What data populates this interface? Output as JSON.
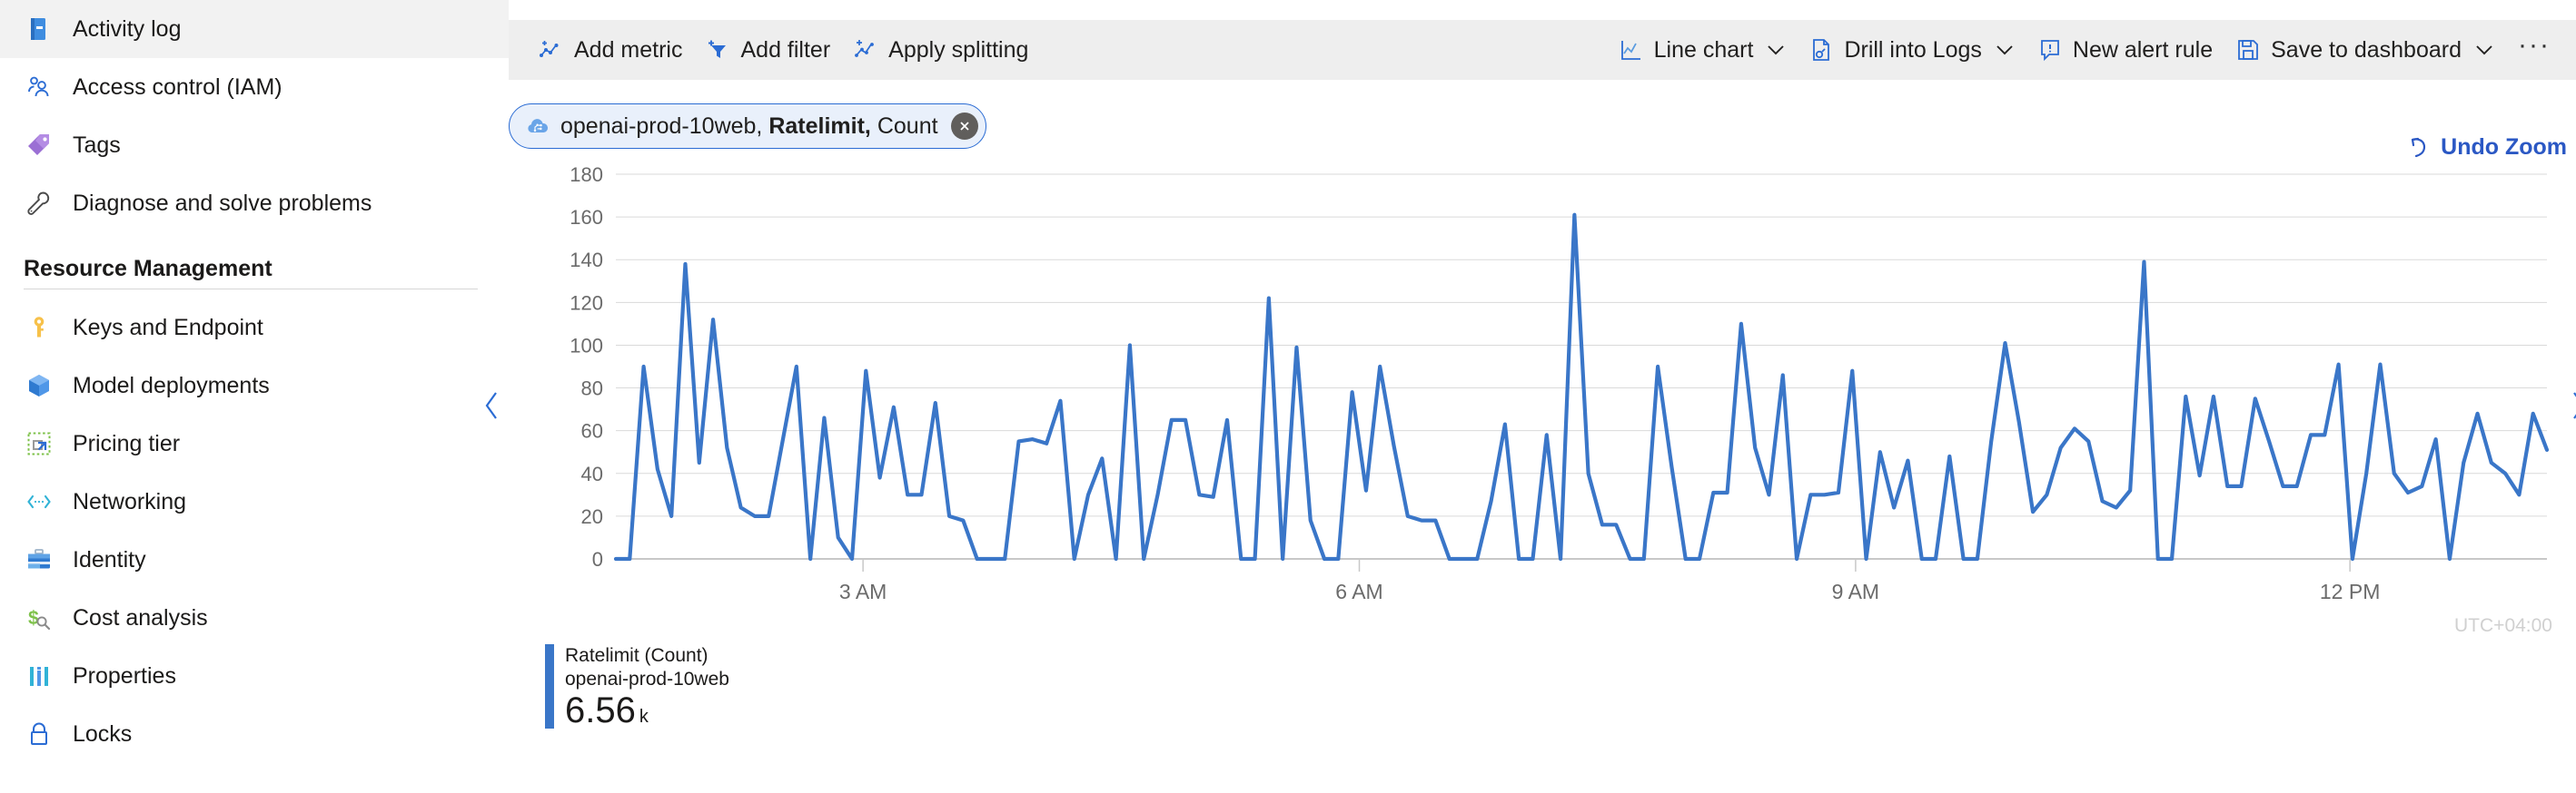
{
  "sidebar": {
    "items": [
      {
        "label": "Activity log",
        "icon": "activity-log-icon"
      },
      {
        "label": "Access control (IAM)",
        "icon": "access-control-icon"
      },
      {
        "label": "Tags",
        "icon": "tag-icon"
      },
      {
        "label": "Diagnose and solve problems",
        "icon": "wrench-icon"
      }
    ],
    "group_header": "Resource Management",
    "group_items": [
      {
        "label": "Keys and Endpoint",
        "icon": "key-icon"
      },
      {
        "label": "Model deployments",
        "icon": "cube-icon"
      },
      {
        "label": "Pricing tier",
        "icon": "pricing-tier-icon"
      },
      {
        "label": "Networking",
        "icon": "networking-icon"
      },
      {
        "label": "Identity",
        "icon": "briefcase-icon"
      },
      {
        "label": "Cost analysis",
        "icon": "cost-analysis-icon"
      },
      {
        "label": "Properties",
        "icon": "properties-icon"
      },
      {
        "label": "Locks",
        "icon": "lock-icon"
      }
    ]
  },
  "toolbar": {
    "left": [
      {
        "label": "Add metric",
        "icon": "add-metric-icon",
        "caret": false
      },
      {
        "label": "Add filter",
        "icon": "add-filter-icon",
        "caret": false
      },
      {
        "label": "Apply splitting",
        "icon": "apply-splitting-icon",
        "caret": false
      }
    ],
    "right": [
      {
        "label": "Line chart",
        "icon": "line-chart-icon",
        "caret": true
      },
      {
        "label": "Drill into Logs",
        "icon": "drill-into-logs-icon",
        "caret": true
      },
      {
        "label": "New alert rule",
        "icon": "new-alert-rule-icon",
        "caret": false
      },
      {
        "label": "Save to dashboard",
        "icon": "save-to-dashboard-icon",
        "caret": true
      }
    ],
    "overflow_label": "···"
  },
  "metric_pill": {
    "resource": "openai-prod-10web,",
    "metric": "Ratelimit,",
    "aggregation": "Count",
    "icon": "cognitive-services-icon",
    "close_icon": "close-icon"
  },
  "undo_zoom": {
    "label": "Undo Zoom",
    "icon": "undo-icon",
    "color": "#2b58c4"
  },
  "nav_chevrons": {
    "left_icon": "chevron-left-icon",
    "right_icon": "chevron-right-icon"
  },
  "legend": {
    "metric_line": "Ratelimit (Count)",
    "resource_line": "openai-prod-10web",
    "value": "6.56",
    "unit": "k",
    "swatch_color": "#3a76c8"
  },
  "chart_data": {
    "type": "line",
    "title": "",
    "xlabel": "",
    "ylabel": "",
    "ylim": [
      0,
      180
    ],
    "yticks": [
      0,
      20,
      40,
      60,
      80,
      100,
      120,
      140,
      160,
      180
    ],
    "xtick_labels": [
      "3 AM",
      "6 AM",
      "9 AM",
      "12 PM"
    ],
    "xtick_positions": [
      0.128,
      0.385,
      0.642,
      0.898
    ],
    "timezone_label": "UTC+04:00",
    "grid": true,
    "legend_position": "below-left",
    "line_color": "#3a76c8",
    "series": [
      {
        "name": "Ratelimit (Count) openai-prod-10web",
        "values": [
          0,
          0,
          90,
          42,
          20,
          138,
          45,
          112,
          52,
          24,
          20,
          20,
          55,
          90,
          0,
          66,
          10,
          0,
          88,
          38,
          71,
          30,
          30,
          73,
          20,
          18,
          0,
          0,
          0,
          55,
          56,
          54,
          74,
          0,
          30,
          47,
          0,
          100,
          0,
          30,
          65,
          65,
          30,
          29,
          65,
          0,
          0,
          122,
          0,
          99,
          18,
          0,
          0,
          78,
          32,
          90,
          53,
          20,
          18,
          18,
          0,
          0,
          0,
          27,
          63,
          0,
          0,
          58,
          0,
          161,
          40,
          16,
          16,
          0,
          0,
          90,
          43,
          0,
          0,
          31,
          31,
          110,
          52,
          30,
          86,
          0,
          30,
          30,
          31,
          88,
          0,
          50,
          24,
          46,
          0,
          0,
          48,
          0,
          0,
          55,
          101,
          64,
          22,
          30,
          52,
          61,
          55,
          27,
          24,
          32,
          139,
          0,
          0,
          76,
          39,
          76,
          34,
          34,
          75,
          55,
          34,
          34,
          58,
          58,
          91,
          0,
          40,
          91,
          40,
          31,
          34,
          56,
          0,
          45,
          68,
          45,
          40,
          30,
          68,
          51
        ]
      }
    ]
  }
}
